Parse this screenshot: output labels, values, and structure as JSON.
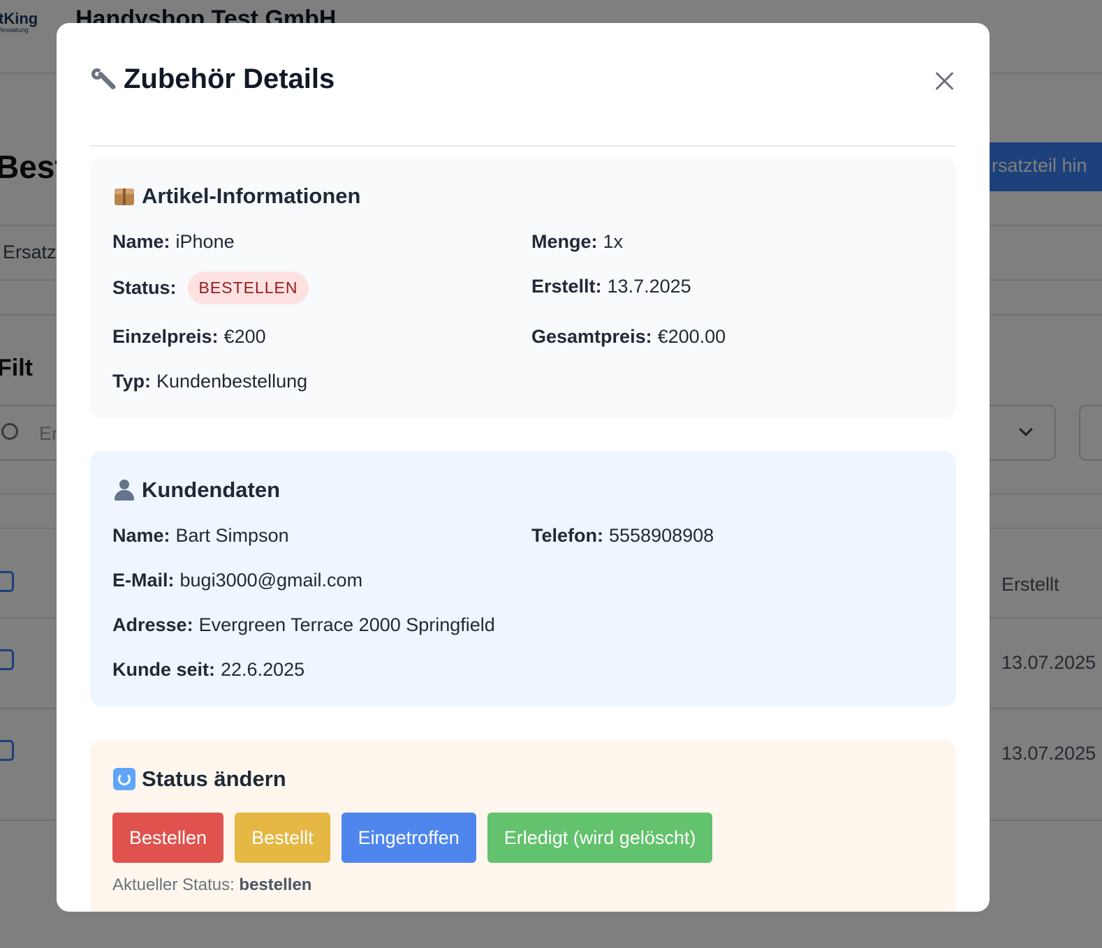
{
  "background": {
    "logo_text": "tKing",
    "logo_subtext": "Verwaltung",
    "company": "Handyshop Test GmbH",
    "page_title": "Best",
    "add_button": "rsatzteil hin",
    "tab_label": "Ersatz",
    "filter_title": "Filt",
    "search_placeholder": "Er",
    "table": {
      "column_header": "Erstellt",
      "dates": [
        "13.07.2025",
        "13.07.2025"
      ]
    }
  },
  "modal": {
    "title": "Zubehör Details",
    "title_icon": "wrench-icon",
    "artikel": {
      "title": "Artikel-Informationen",
      "icon": "package-icon",
      "name_label": "Name:",
      "name_value": "iPhone",
      "menge_label": "Menge:",
      "menge_value": "1x",
      "status_label": "Status:",
      "status_value": "BESTELLEN",
      "erstellt_label": "Erstellt:",
      "erstellt_value": "13.7.2025",
      "einzelpreis_label": "Einzelpreis:",
      "einzelpreis_value": "€200",
      "gesamtpreis_label": "Gesamtpreis:",
      "gesamtpreis_value": "€200.00",
      "typ_label": "Typ:",
      "typ_value": "Kundenbestellung"
    },
    "kunde": {
      "title": "Kundendaten",
      "icon": "user-icon",
      "name_label": "Name:",
      "name_value": "Bart Simpson",
      "telefon_label": "Telefon:",
      "telefon_value": "5558908908",
      "email_label": "E-Mail:",
      "email_value": "bugi3000@gmail.com",
      "adresse_label": "Adresse:",
      "adresse_value": "Evergreen Terrace 2000 Springfield",
      "seit_label": "Kunde seit:",
      "seit_value": "22.6.2025"
    },
    "status": {
      "title": "Status ändern",
      "icon": "cycle-icon",
      "buttons": {
        "bestellen": "Bestellen",
        "bestellt": "Bestellt",
        "eingetroffen": "Eingetroffen",
        "erledigt": "Erledigt (wird gelöscht)"
      },
      "current_label": "Aktueller Status:",
      "current_value": "bestellen"
    }
  },
  "colors": {
    "red": "#e0524d",
    "yellow": "#e5b743",
    "blue": "#4e86ee",
    "green": "#63c26d",
    "badge_bg": "#fee2e2",
    "badge_text": "#991b1b"
  }
}
